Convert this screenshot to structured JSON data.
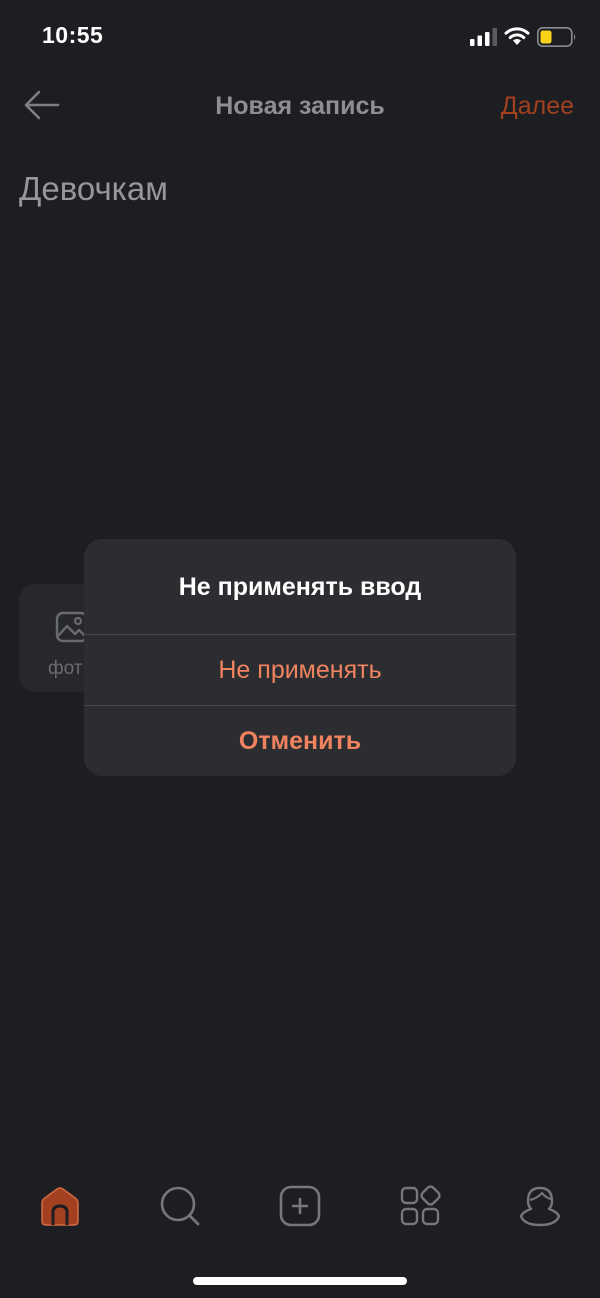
{
  "status_bar": {
    "time": "10:55"
  },
  "nav": {
    "title": "Новая запись",
    "next_label": "Далее"
  },
  "post": {
    "text": "Девочкам"
  },
  "attachments": [
    {
      "label": "фот",
      "icon": "image-icon"
    }
  ],
  "dialog": {
    "title": "Не применять ввод",
    "discard_label": "Не применять",
    "cancel_label": "Отменить"
  },
  "tabbar": {
    "items": [
      {
        "name": "home",
        "icon": "home-icon",
        "active": true
      },
      {
        "name": "search",
        "icon": "search-icon",
        "active": false
      },
      {
        "name": "create",
        "icon": "plus-square-icon",
        "active": false
      },
      {
        "name": "services",
        "icon": "grid-icon",
        "active": false
      },
      {
        "name": "profile",
        "icon": "user-icon",
        "active": false
      }
    ]
  },
  "colors": {
    "accent": "#f0835f",
    "accent_dim": "#a3401f",
    "background": "#1c1e21",
    "dialog": "#2c2d30"
  }
}
